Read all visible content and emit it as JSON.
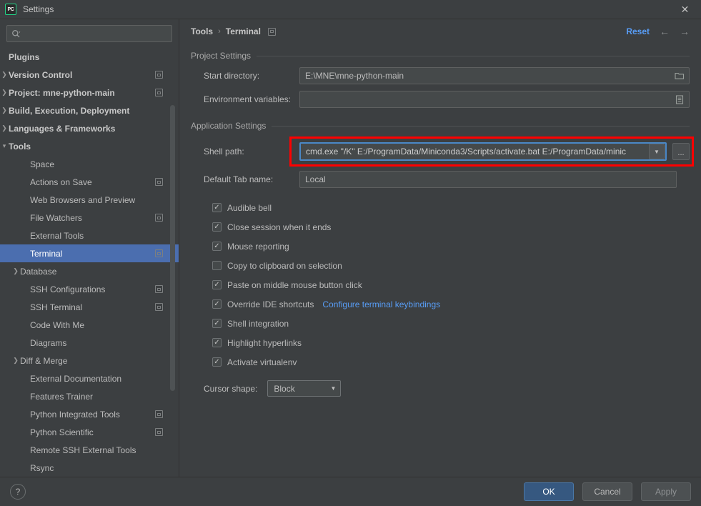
{
  "window": {
    "title": "Settings",
    "logo_text": "PC",
    "close_icon": "close-icon"
  },
  "sidebar": {
    "search": {
      "placeholder": "",
      "value": "",
      "icon": "search-icon"
    },
    "items": [
      {
        "label": "Plugins",
        "bold": true,
        "arrow": "",
        "indent": 14,
        "cfg": false,
        "selected": false
      },
      {
        "label": "Version Control",
        "bold": true,
        "arrow": "›",
        "indent": 14,
        "cfg": true,
        "selected": false
      },
      {
        "label": "Project: mne-python-main",
        "bold": true,
        "arrow": "›",
        "indent": 14,
        "cfg": true,
        "selected": false
      },
      {
        "label": "Build, Execution, Deployment",
        "bold": true,
        "arrow": "›",
        "indent": 14,
        "cfg": false,
        "selected": false
      },
      {
        "label": "Languages & Frameworks",
        "bold": true,
        "arrow": "›",
        "indent": 14,
        "cfg": false,
        "selected": false
      },
      {
        "label": "Tools",
        "bold": true,
        "arrow": "⌄",
        "indent": 14,
        "cfg": false,
        "selected": false
      },
      {
        "label": "Space",
        "bold": false,
        "arrow": "",
        "indent": 44,
        "cfg": false,
        "selected": false
      },
      {
        "label": "Actions on Save",
        "bold": false,
        "arrow": "",
        "indent": 44,
        "cfg": true,
        "selected": false
      },
      {
        "label": "Web Browsers and Preview",
        "bold": false,
        "arrow": "",
        "indent": 44,
        "cfg": false,
        "selected": false
      },
      {
        "label": "File Watchers",
        "bold": false,
        "arrow": "",
        "indent": 44,
        "cfg": true,
        "selected": false
      },
      {
        "label": "External Tools",
        "bold": false,
        "arrow": "",
        "indent": 44,
        "cfg": false,
        "selected": false
      },
      {
        "label": "Terminal",
        "bold": false,
        "arrow": "",
        "indent": 44,
        "cfg": true,
        "selected": true
      },
      {
        "label": "Database",
        "bold": false,
        "arrow": "›",
        "indent": 30,
        "cfg": false,
        "selected": false
      },
      {
        "label": "SSH Configurations",
        "bold": false,
        "arrow": "",
        "indent": 44,
        "cfg": true,
        "selected": false
      },
      {
        "label": "SSH Terminal",
        "bold": false,
        "arrow": "",
        "indent": 44,
        "cfg": true,
        "selected": false
      },
      {
        "label": "Code With Me",
        "bold": false,
        "arrow": "",
        "indent": 44,
        "cfg": false,
        "selected": false
      },
      {
        "label": "Diagrams",
        "bold": false,
        "arrow": "",
        "indent": 44,
        "cfg": false,
        "selected": false
      },
      {
        "label": "Diff & Merge",
        "bold": false,
        "arrow": "›",
        "indent": 30,
        "cfg": false,
        "selected": false
      },
      {
        "label": "External Documentation",
        "bold": false,
        "arrow": "",
        "indent": 44,
        "cfg": false,
        "selected": false
      },
      {
        "label": "Features Trainer",
        "bold": false,
        "arrow": "",
        "indent": 44,
        "cfg": false,
        "selected": false
      },
      {
        "label": "Python Integrated Tools",
        "bold": false,
        "arrow": "",
        "indent": 44,
        "cfg": true,
        "selected": false
      },
      {
        "label": "Python Scientific",
        "bold": false,
        "arrow": "",
        "indent": 44,
        "cfg": true,
        "selected": false
      },
      {
        "label": "Remote SSH External Tools",
        "bold": false,
        "arrow": "",
        "indent": 44,
        "cfg": false,
        "selected": false
      },
      {
        "label": "Rsync",
        "bold": false,
        "arrow": "",
        "indent": 44,
        "cfg": false,
        "selected": false
      }
    ]
  },
  "header": {
    "breadcrumb": [
      "Tools",
      "Terminal"
    ],
    "separator": "›",
    "reset_label": "Reset",
    "back_arrow": "←",
    "forward_arrow": "→"
  },
  "project_settings": {
    "title": "Project Settings",
    "start_directory": {
      "label": "Start directory:",
      "value": "E:\\MNE\\mne-python-main",
      "trail_icon": "folder-icon"
    },
    "environment_variables": {
      "label": "Environment variables:",
      "value": "",
      "trail_icon": "list-icon"
    }
  },
  "application_settings": {
    "title": "Application Settings",
    "shell_path": {
      "label": "Shell path:",
      "value": "cmd.exe \"/K\" E:/ProgramData/Miniconda3/Scripts/activate.bat E:/ProgramData/minic",
      "dropdown_icon": "chevron-down-icon",
      "browse_label": "...",
      "highlight_color": "#fe0000",
      "focus_color": "#4a88c7"
    },
    "default_tab_name": {
      "label": "Default Tab name:",
      "value": "Local"
    },
    "checkboxes": [
      {
        "label": "Audible bell",
        "checked": true,
        "link": ""
      },
      {
        "label": "Close session when it ends",
        "checked": true,
        "link": ""
      },
      {
        "label": "Mouse reporting",
        "checked": true,
        "link": ""
      },
      {
        "label": "Copy to clipboard on selection",
        "checked": false,
        "link": ""
      },
      {
        "label": "Paste on middle mouse button click",
        "checked": true,
        "link": ""
      },
      {
        "label": "Override IDE shortcuts",
        "checked": true,
        "link": "Configure terminal keybindings"
      },
      {
        "label": "Shell integration",
        "checked": true,
        "link": ""
      },
      {
        "label": "Highlight hyperlinks",
        "checked": true,
        "link": ""
      },
      {
        "label": "Activate virtualenv",
        "checked": true,
        "link": ""
      }
    ],
    "cursor_shape": {
      "label": "Cursor shape:",
      "value": "Block",
      "arrow_icon": "chevron-down-icon"
    }
  },
  "footer": {
    "help_label": "?",
    "ok_label": "OK",
    "cancel_label": "Cancel",
    "apply_label": "Apply"
  }
}
